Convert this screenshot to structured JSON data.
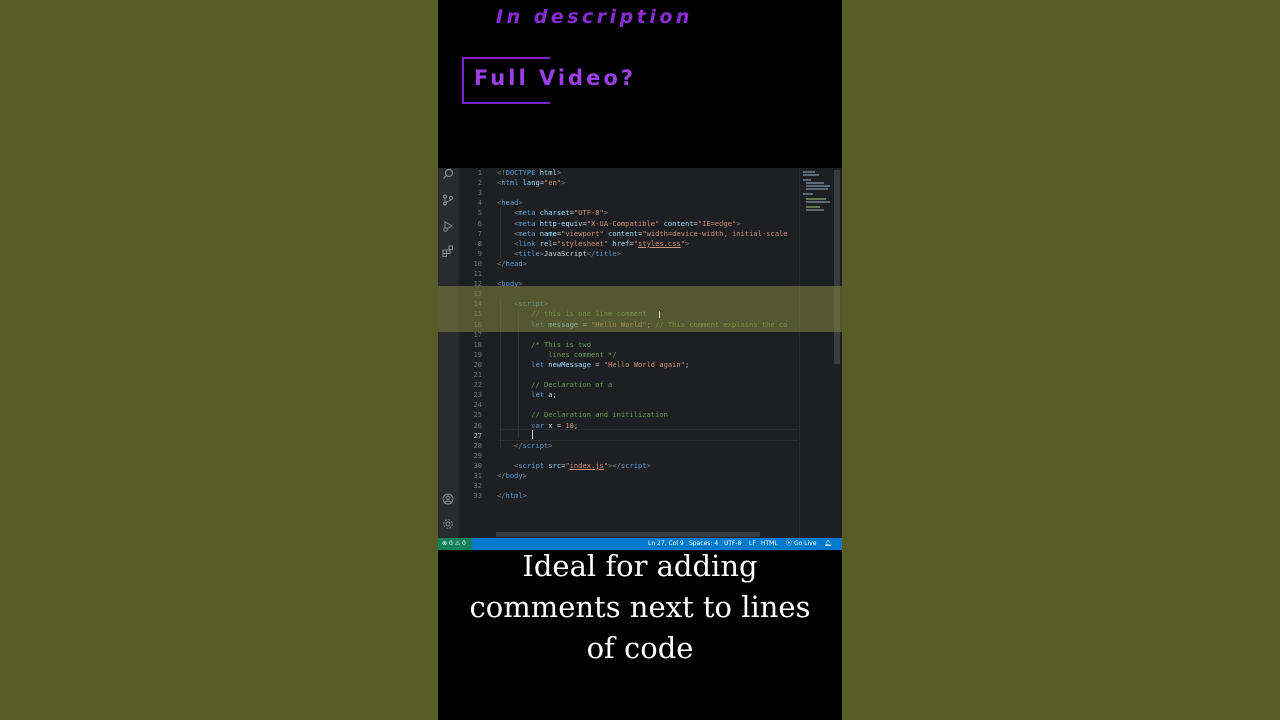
{
  "promo": {
    "description": "In description",
    "full_video": "Full Video?"
  },
  "editor": {
    "lines": [
      {
        "n": "1",
        "segs": [
          [
            "t-tag",
            "<!"
          ],
          [
            "t-doc",
            "DOCTYPE"
          ],
          [
            "t-text",
            " "
          ],
          [
            "t-attr",
            "html"
          ],
          [
            "t-tag",
            ">"
          ]
        ]
      },
      {
        "n": "2",
        "segs": [
          [
            "t-tag",
            "<"
          ],
          [
            "t-tagname",
            "html"
          ],
          [
            "t-text",
            " "
          ],
          [
            "t-attr",
            "lang"
          ],
          [
            "t-text",
            "="
          ],
          [
            "t-str",
            "\"en\""
          ],
          [
            "t-tag",
            ">"
          ]
        ]
      },
      {
        "n": "3",
        "segs": []
      },
      {
        "n": "4",
        "segs": [
          [
            "t-tag",
            "<"
          ],
          [
            "t-tagname",
            "head"
          ],
          [
            "t-tag",
            ">"
          ]
        ]
      },
      {
        "n": "5",
        "segs": [
          [
            "t-text",
            "    "
          ],
          [
            "t-tag",
            "<"
          ],
          [
            "t-tagname",
            "meta"
          ],
          [
            "t-text",
            " "
          ],
          [
            "t-attr",
            "charset"
          ],
          [
            "t-text",
            "="
          ],
          [
            "t-str",
            "\"UTF-8\""
          ],
          [
            "t-tag",
            ">"
          ]
        ]
      },
      {
        "n": "6",
        "segs": [
          [
            "t-text",
            "    "
          ],
          [
            "t-tag",
            "<"
          ],
          [
            "t-tagname",
            "meta"
          ],
          [
            "t-text",
            " "
          ],
          [
            "t-attr",
            "http-equiv"
          ],
          [
            "t-text",
            "="
          ],
          [
            "t-str",
            "\"X-UA-Compatible\""
          ],
          [
            "t-text",
            " "
          ],
          [
            "t-attr",
            "content"
          ],
          [
            "t-text",
            "="
          ],
          [
            "t-str",
            "\"IE=edge\""
          ],
          [
            "t-tag",
            ">"
          ]
        ]
      },
      {
        "n": "7",
        "segs": [
          [
            "t-text",
            "    "
          ],
          [
            "t-tag",
            "<"
          ],
          [
            "t-tagname",
            "meta"
          ],
          [
            "t-text",
            " "
          ],
          [
            "t-attr",
            "name"
          ],
          [
            "t-text",
            "="
          ],
          [
            "t-str",
            "\"viewport\""
          ],
          [
            "t-text",
            " "
          ],
          [
            "t-attr",
            "content"
          ],
          [
            "t-text",
            "="
          ],
          [
            "t-str",
            "\"width=device-width, initial-scale"
          ]
        ]
      },
      {
        "n": "8",
        "segs": [
          [
            "t-text",
            "    "
          ],
          [
            "t-tag",
            "<"
          ],
          [
            "t-tagname",
            "link"
          ],
          [
            "t-text",
            " "
          ],
          [
            "t-attr",
            "rel"
          ],
          [
            "t-text",
            "="
          ],
          [
            "t-str",
            "\"stylesheet\""
          ],
          [
            "t-text",
            " "
          ],
          [
            "t-attr",
            "href"
          ],
          [
            "t-text",
            "="
          ],
          [
            "t-str",
            "\""
          ],
          [
            "t-str t-link",
            "styles.css"
          ],
          [
            "t-str",
            "\""
          ],
          [
            "t-tag",
            ">"
          ]
        ]
      },
      {
        "n": "9",
        "segs": [
          [
            "t-text",
            "    "
          ],
          [
            "t-tag",
            "<"
          ],
          [
            "t-tagname",
            "title"
          ],
          [
            "t-tag",
            ">"
          ],
          [
            "t-text",
            "JavaScript"
          ],
          [
            "t-tag",
            "</"
          ],
          [
            "t-tagname",
            "title"
          ],
          [
            "t-tag",
            ">"
          ]
        ]
      },
      {
        "n": "10",
        "segs": [
          [
            "t-tag",
            "</"
          ],
          [
            "t-tagname",
            "head"
          ],
          [
            "t-tag",
            ">"
          ]
        ]
      },
      {
        "n": "11",
        "segs": []
      },
      {
        "n": "12",
        "segs": [
          [
            "t-tag",
            "<"
          ],
          [
            "t-tagname",
            "body"
          ],
          [
            "t-tag",
            ">"
          ]
        ]
      },
      {
        "n": "13",
        "segs": []
      },
      {
        "n": "14",
        "segs": [
          [
            "t-text",
            "    "
          ],
          [
            "t-tag",
            "<"
          ],
          [
            "t-tagname",
            "script"
          ],
          [
            "t-tag",
            ">"
          ]
        ]
      },
      {
        "n": "15",
        "segs": [
          [
            "t-text",
            "        "
          ],
          [
            "t-com",
            "// this is one line comment"
          ]
        ]
      },
      {
        "n": "16",
        "segs": [
          [
            "t-text",
            "        "
          ],
          [
            "t-kw",
            "let"
          ],
          [
            "t-text",
            " "
          ],
          [
            "t-attr",
            "message"
          ],
          [
            "t-text",
            " = "
          ],
          [
            "t-str",
            "\"Hello World\""
          ],
          [
            "t-text",
            "; "
          ],
          [
            "t-com",
            "// This comment explains the co"
          ]
        ]
      },
      {
        "n": "17",
        "segs": []
      },
      {
        "n": "18",
        "segs": [
          [
            "t-text",
            "        "
          ],
          [
            "t-com",
            "/* This is two"
          ]
        ]
      },
      {
        "n": "19",
        "segs": [
          [
            "t-text",
            "        "
          ],
          [
            "t-com",
            "    lines comment */"
          ]
        ]
      },
      {
        "n": "20",
        "segs": [
          [
            "t-text",
            "        "
          ],
          [
            "t-kw",
            "let"
          ],
          [
            "t-text",
            " "
          ],
          [
            "t-attr",
            "newMessage"
          ],
          [
            "t-text",
            " = "
          ],
          [
            "t-str",
            "\"Hello World again\""
          ],
          [
            "t-text",
            ";"
          ]
        ]
      },
      {
        "n": "21",
        "segs": []
      },
      {
        "n": "22",
        "segs": [
          [
            "t-text",
            "        "
          ],
          [
            "t-com",
            "// Declaration of a"
          ]
        ]
      },
      {
        "n": "23",
        "segs": [
          [
            "t-text",
            "        "
          ],
          [
            "t-kw",
            "let"
          ],
          [
            "t-text",
            " "
          ],
          [
            "t-attr",
            "a"
          ],
          [
            "t-text",
            ";"
          ]
        ]
      },
      {
        "n": "24",
        "segs": []
      },
      {
        "n": "25",
        "segs": [
          [
            "t-text",
            "        "
          ],
          [
            "t-com",
            "// Declaration and initilization"
          ]
        ]
      },
      {
        "n": "26",
        "segs": [
          [
            "t-text",
            "        "
          ],
          [
            "t-kw",
            "var"
          ],
          [
            "t-text",
            " "
          ],
          [
            "t-attr",
            "x"
          ],
          [
            "t-text",
            " = "
          ],
          [
            "t-str",
            "10"
          ],
          [
            "t-text",
            ";"
          ]
        ]
      },
      {
        "n": "27",
        "segs": []
      },
      {
        "n": "28",
        "segs": [
          [
            "t-text",
            "    "
          ],
          [
            "t-tag",
            "</"
          ],
          [
            "t-tagname",
            "script"
          ],
          [
            "t-tag",
            ">"
          ]
        ]
      },
      {
        "n": "29",
        "segs": []
      },
      {
        "n": "30",
        "segs": [
          [
            "t-text",
            "    "
          ],
          [
            "t-tag",
            "<"
          ],
          [
            "t-tagname",
            "script"
          ],
          [
            "t-text",
            " "
          ],
          [
            "t-attr",
            "src"
          ],
          [
            "t-text",
            "="
          ],
          [
            "t-str",
            "\""
          ],
          [
            "t-str t-link",
            "index.js"
          ],
          [
            "t-str",
            "\""
          ],
          [
            "t-tag",
            "></"
          ],
          [
            "t-tagname",
            "script"
          ],
          [
            "t-tag",
            ">"
          ]
        ]
      },
      {
        "n": "31",
        "segs": [
          [
            "t-tag",
            "</"
          ],
          [
            "t-tagname",
            "body"
          ],
          [
            "t-tag",
            ">"
          ]
        ]
      },
      {
        "n": "32",
        "segs": []
      },
      {
        "n": "33",
        "segs": [
          [
            "t-tag",
            "</"
          ],
          [
            "t-tagname",
            "html"
          ],
          [
            "t-tag",
            ">"
          ]
        ]
      }
    ],
    "active_line": "27"
  },
  "activity_bar": {
    "icons": [
      "search-icon",
      "source-control-icon",
      "run-debug-icon",
      "extensions-icon",
      "account-icon",
      "settings-gear-icon"
    ]
  },
  "statusbar": {
    "errors": "0",
    "warnings": "0",
    "position": "Ln 27, Col 9",
    "spaces": "Spaces: 4",
    "encoding": "UTF-8",
    "eol": "LF",
    "language": "HTML",
    "go_live": "Go Live",
    "colors": {
      "bar": "#007acc",
      "remote": "#16825d"
    }
  },
  "caption": {
    "line1": "Ideal for adding",
    "line2": "comments next to lines",
    "line3": "of code"
  }
}
